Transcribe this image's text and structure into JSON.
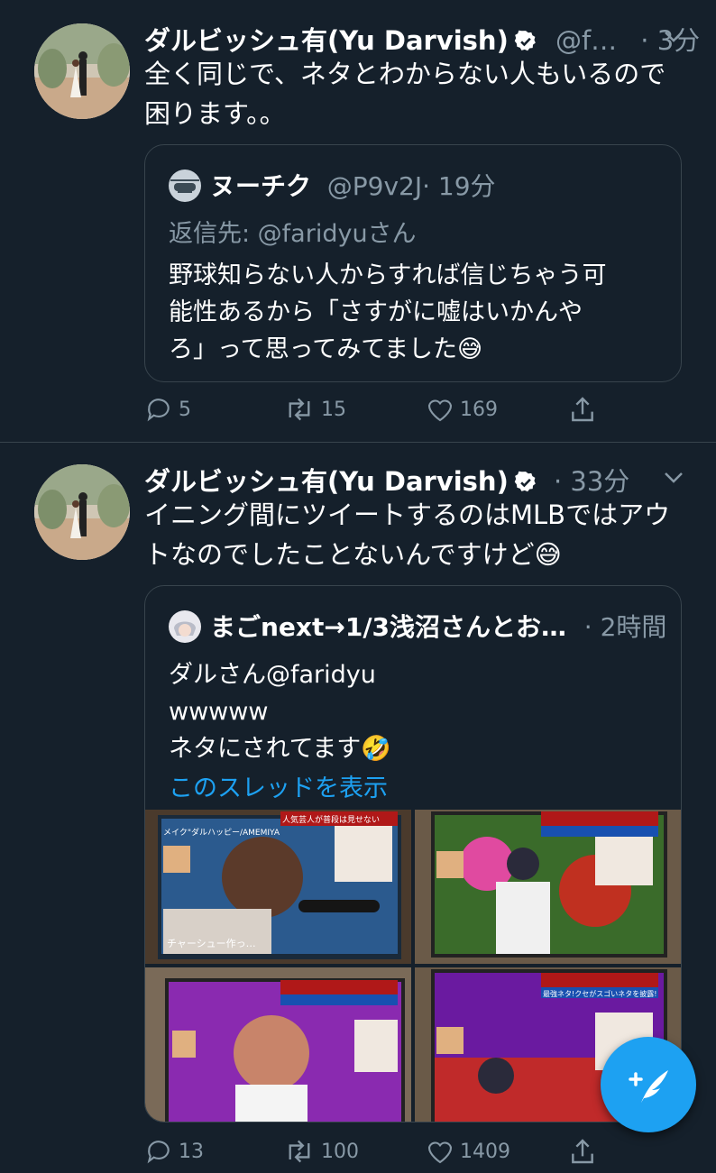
{
  "tweets": [
    {
      "author": "ダルビッシュ有(Yu Darvish)",
      "handle": "@f…",
      "time": "· 3分",
      "text_lines": [
        "全く同じで、ネタとわからない人もいるので",
        "困ります。。"
      ],
      "quote": {
        "author": "ヌーチク",
        "handle": "@P9v2J",
        "time": "· 19分",
        "reply_to": "返信先: @faridyuさん",
        "text_lines": [
          "野球知らない人からすれば信じちゃう可",
          "能性あるから「さすがに嘘はいかんや",
          "ろ」って思ってみてました😅"
        ]
      },
      "actions": {
        "replies": "5",
        "retweets": "15",
        "likes": "169"
      }
    },
    {
      "author": "ダルビッシュ有(Yu Darvish)",
      "handle": "",
      "time": "· 33分",
      "text_lines": [
        "イニング間にツイートするのはMLBではアウ",
        "トなのでしたことないんですけど😅"
      ],
      "quote": {
        "author": "まごnext→1/3浅沼さんとお…",
        "handle": "",
        "time": "· 2時間",
        "text_lines": [
          "ダルさん@faridyu",
          "wwwww",
          "ネタにされてます🤣"
        ],
        "thread_link": "このスレッドを表示",
        "media_caption_1": "メイク\"ダルハッピー/AMEMIYA",
        "media_banner": "人気芸人が普段は見せない",
        "media_sub": "最強ネタ!クセがスゴいネタを披露!",
        "media_bottom": "チャーシュー作っ…"
      },
      "actions": {
        "replies": "13",
        "retweets": "100",
        "likes": "1409"
      }
    }
  ],
  "icons": {
    "verified": "verified-badge-icon",
    "reply": "reply-icon",
    "retweet": "retweet-icon",
    "like": "heart-icon",
    "share": "share-icon",
    "compose": "compose-tweet-icon"
  },
  "colors": {
    "background": "#15202b",
    "border": "#38444d",
    "muted": "#8899a6",
    "accent": "#1da1f2"
  }
}
